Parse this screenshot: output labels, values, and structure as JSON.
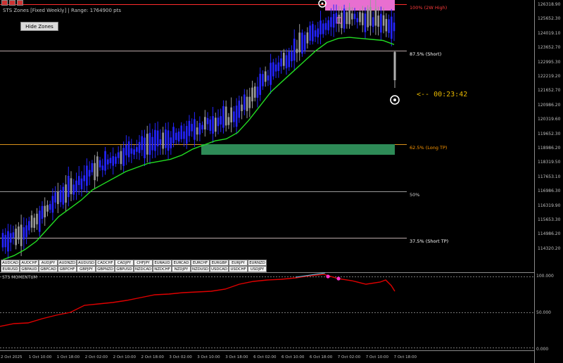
{
  "header": {
    "indicator_text": "STS Zones [Fixed Weekly] | Range: 1764900 pts",
    "top_icons": [
      "square-red-icon",
      "square-red-icon",
      "square-red-icon"
    ]
  },
  "buttons": {
    "hide_zones": "Hide Zones"
  },
  "zones": [
    {
      "label": "100% (2W High)",
      "color": "#ff3b3b",
      "price": 126318.9
    },
    {
      "label": "87.5% (Short)",
      "color": "#ffffff",
      "price": 124034
    },
    {
      "label": "62.5% (Long TP)",
      "color": "#ff9800",
      "price": 119665
    },
    {
      "label": "50%",
      "color": "#cfcfcf",
      "price": 117471
    },
    {
      "label": "37.5% (Short TP)",
      "color": "#ffffff",
      "price": 115275
    }
  ],
  "price_axis": [
    "126318.90",
    "125652.30",
    "124019.10",
    "123652.70",
    "122995.30",
    "122219.20",
    "121652.70",
    "120986.20",
    "120319.60",
    "119652.30",
    "118986.20",
    "118319.50",
    "117653.10",
    "116986.30",
    "116319.90",
    "115653.30",
    "114986.20",
    "114320.20"
  ],
  "countdown": "<-- 00:23:42",
  "pairs": {
    "row1": [
      "AUDCAD",
      "AUDCHF",
      "AUDJPY",
      "AUDNZD",
      "AUDUSD",
      "CADCHF",
      "CADJPY",
      "CHFJPY",
      "EURAUD",
      "EURCAD",
      "EURCHF",
      "EURGBP",
      "EURJPY",
      "EURNZD"
    ],
    "row2": [
      "EURUSD",
      "GBPAUD",
      "GBPCAD",
      "GBPCHF",
      "GBPJPY",
      "GBPNZD",
      "GBPUSD",
      "NZDCAD",
      "NZDCHF",
      "NZDJPY",
      "NZDUSD",
      "USDCAD",
      "USDCHF",
      "USDJPY"
    ]
  },
  "indicator": {
    "title": "STS MOMENTUM",
    "ticks": [
      "100.000",
      "50.000",
      "0.000"
    ]
  },
  "time_axis": [
    "2 Oct 2025",
    "1 Oct 10:00",
    "1 Oct 18:00",
    "2 Oct 02:00",
    "2 Oct 10:00",
    "2 Oct 18:00",
    "3 Oct 02:00",
    "3 Oct 10:00",
    "3 Oct 18:00",
    "6 Oct 02:00",
    "6 Oct 10:00",
    "6 Oct 18:00",
    "7 Oct 02:00",
    "7 Oct 10:00",
    "7 Oct 18:00"
  ],
  "colors": {
    "bull_candle": "#2424ff",
    "bear_candle": "#9a9a9a",
    "ma_line": "#22dd22",
    "zone_high_fill": "#e86fd0",
    "zone_low_fill": "#2e8b57",
    "momentum_line": "#e00000"
  },
  "chart_data": {
    "type": "line",
    "title": "",
    "xlabel": "",
    "ylabel": "",
    "ylim": [
      114000,
      126500
    ],
    "series": [
      {
        "values": [
          114100,
          114300,
          114600,
          115000,
          115600,
          116200,
          116600,
          117000,
          117500,
          117800,
          118100,
          118400,
          118600,
          118800,
          118900,
          119000,
          119200,
          119500,
          119700,
          119900,
          120000,
          120300,
          120900,
          121600,
          122300,
          122800,
          123300,
          123800,
          124300,
          124700,
          124900,
          124950,
          124900,
          124850,
          124800,
          124600
        ]
      }
    ]
  }
}
